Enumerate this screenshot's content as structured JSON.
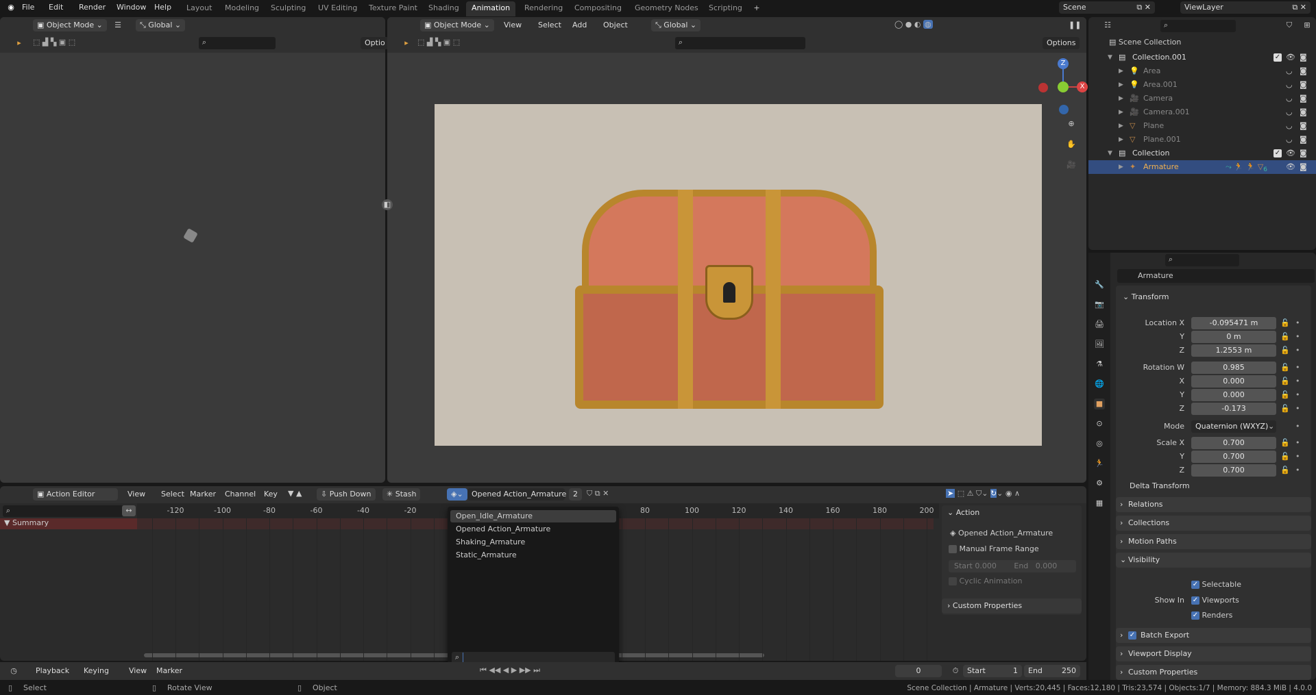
{
  "topmenu": [
    "File",
    "Edit",
    "Render",
    "Window",
    "Help"
  ],
  "workspaces": [
    "Layout",
    "Modeling",
    "Sculpting",
    "UV Editing",
    "Texture Paint",
    "Shading",
    "Animation",
    "Rendering",
    "Compositing",
    "Geometry Nodes",
    "Scripting"
  ],
  "active_workspace": "Animation",
  "scene": "Scene",
  "view_layer": "ViewLayer",
  "left_viewport": {
    "mode": "Object Mode",
    "orientation": "Global",
    "options": "Optio"
  },
  "main_viewport": {
    "mode": "Object Mode",
    "menus": [
      "View",
      "Select",
      "Add",
      "Object"
    ],
    "orientation": "Global",
    "options": "Options"
  },
  "gizmo": {
    "z": "Z",
    "x": "X"
  },
  "outliner": {
    "root": "Scene Collection",
    "rows": [
      {
        "label": "Collection.001",
        "level": 1,
        "type": "collection"
      },
      {
        "label": "Area",
        "level": 2,
        "type": "light"
      },
      {
        "label": "Area.001",
        "level": 2,
        "type": "light"
      },
      {
        "label": "Camera",
        "level": 2,
        "type": "camera"
      },
      {
        "label": "Camera.001",
        "level": 2,
        "type": "camera"
      },
      {
        "label": "Plane",
        "level": 2,
        "type": "mesh"
      },
      {
        "label": "Plane.001",
        "level": 2,
        "type": "mesh"
      },
      {
        "label": "Collection",
        "level": 1,
        "type": "collection"
      },
      {
        "label": "Armature",
        "level": 2,
        "type": "armature",
        "selected": true,
        "badge": "6"
      }
    ]
  },
  "properties": {
    "object_name": "Armature",
    "transform_title": "Transform",
    "rows": [
      {
        "label": "Location X",
        "value": "-0.095471 m"
      },
      {
        "label": "Y",
        "value": "0 m"
      },
      {
        "label": "Z",
        "value": "1.2553 m"
      },
      {
        "label": "Rotation W",
        "value": "0.985"
      },
      {
        "label": "X",
        "value": "0.000"
      },
      {
        "label": "Y",
        "value": "0.000"
      },
      {
        "label": "Z",
        "value": "-0.173"
      },
      {
        "label": "Mode",
        "value": "Quaternion (WXYZ)",
        "dropdown": true
      },
      {
        "label": "Scale X",
        "value": "0.700"
      },
      {
        "label": "Y",
        "value": "0.700"
      },
      {
        "label": "Z",
        "value": "0.700"
      }
    ],
    "delta_transform": "Delta Transform",
    "panels": [
      "Relations",
      "Collections",
      "Motion Paths"
    ],
    "visibility": {
      "title": "Visibility",
      "selectable": "Selectable",
      "show_in": "Show In",
      "viewports": "Viewports",
      "renders": "Renders"
    },
    "panels_after": [
      "Batch Export",
      "Viewport Display",
      "Custom Properties"
    ]
  },
  "action_editor": {
    "editor": "Action Editor",
    "menus": [
      "View",
      "Select",
      "Marker",
      "Channel",
      "Key"
    ],
    "push_down": "Push Down",
    "stash": "Stash",
    "action": "Opened Action_Armature",
    "users": "2",
    "summary": "Summary",
    "ticks": [
      "-120",
      "-100",
      "-80",
      "-60",
      "-40",
      "-20",
      "80",
      "100",
      "120",
      "140",
      "160",
      "180",
      "200"
    ],
    "tick_frames": [
      -120,
      -100,
      -80,
      -60,
      -40,
      -20,
      80,
      100,
      120,
      140,
      160,
      180,
      200
    ],
    "dropdown": [
      "Open_Idle_Armature",
      "Opened Action_Armature",
      "Shaking_Armature",
      "Static_Armature"
    ],
    "sidebar": {
      "title": "Action",
      "action": "Opened Action_Armature",
      "manual_range": "Manual Frame Range",
      "start_label": "Start",
      "start": "0.000",
      "end_label": "End",
      "end": "0.000",
      "cyclic": "Cyclic Animation",
      "custom": "Custom Properties"
    }
  },
  "timeline": {
    "menus": [
      "Playback",
      "Keying",
      "View",
      "Marker"
    ],
    "current_frame": "0",
    "start_label": "Start",
    "start": "1",
    "end_label": "End",
    "end": "250"
  },
  "status": {
    "select": "Select",
    "rotate": "Rotate View",
    "object": "Object",
    "info": "Scene Collection | Armature | Verts:20,445 | Faces:12,180 | Tris:23,574 | Objects:1/7 | Memory: 884.3 MiB | 4.0.0"
  },
  "colors": {
    "accent": "#4772b3",
    "selected_row": "#334d80",
    "summary": "#5a2a2a",
    "render_bg": "#c8c0b4"
  }
}
